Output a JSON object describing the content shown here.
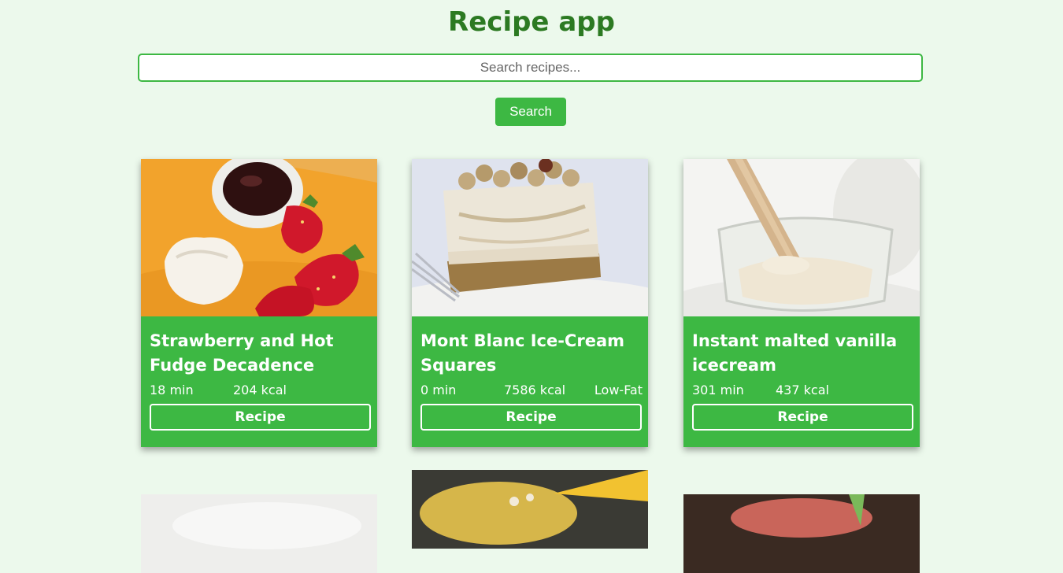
{
  "app": {
    "title": "Recipe app"
  },
  "search": {
    "placeholder": "Search recipes...",
    "button_label": "Search"
  },
  "recipes": [
    {
      "title": "Strawberry and Hot Fudge Decadence",
      "time": "18 min",
      "kcal": "204 kcal",
      "label": "",
      "button_label": "Recipe"
    },
    {
      "title": "Mont Blanc Ice-Cream Squares",
      "time": "0 min",
      "kcal": "7586 kcal",
      "label": "Low-Fat",
      "button_label": "Recipe"
    },
    {
      "title": "Instant malted vanilla icecream",
      "time": "301 min",
      "kcal": "437 kcal",
      "label": "",
      "button_label": "Recipe"
    }
  ],
  "colors": {
    "background": "#ecf9ec",
    "accent": "#3db843",
    "title": "#2c7a22"
  }
}
